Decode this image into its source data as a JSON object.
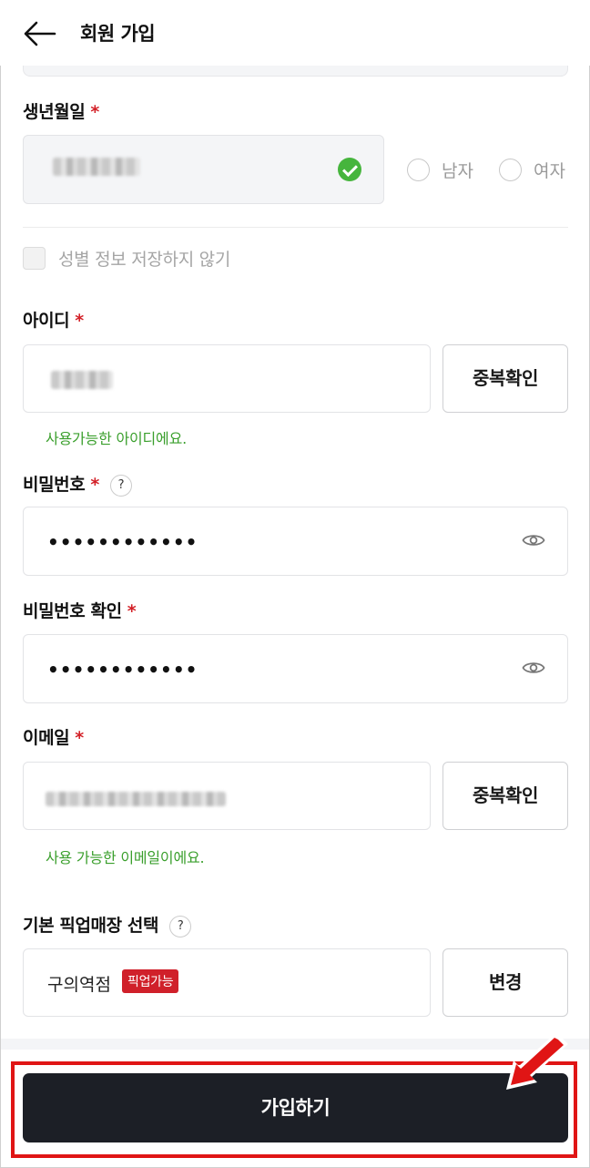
{
  "header": {
    "title": "회원 가입"
  },
  "birth": {
    "label": "생년월일",
    "required_mark": "*"
  },
  "gender": {
    "male": "남자",
    "female": "여자",
    "no_save_label": "성별 정보 저장하지 않기"
  },
  "user_id": {
    "label": "아이디",
    "required_mark": "*",
    "check_button": "중복확인",
    "success_message": "사용가능한 아이디에요."
  },
  "password": {
    "label": "비밀번호",
    "required_mark": "*",
    "help": "?",
    "value_masked": "••••••••••••"
  },
  "password_confirm": {
    "label": "비밀번호 확인",
    "required_mark": "*",
    "value_masked": "••••••••••••"
  },
  "email": {
    "label": "이메일",
    "required_mark": "*",
    "check_button": "중복확인",
    "success_message": "사용 가능한 이메일이에요."
  },
  "pickup_store": {
    "label": "기본 픽업매장 선택",
    "help": "?",
    "store_name": "구의역점",
    "badge": "픽업가능",
    "change_button": "변경"
  },
  "submit": {
    "label": "가입하기"
  },
  "colors": {
    "required": "#d32027",
    "success": "#3a9f2c",
    "badge": "#d0202a",
    "submit_bg": "#1c1f26",
    "highlight": "#e01515",
    "check": "#46b53d"
  }
}
